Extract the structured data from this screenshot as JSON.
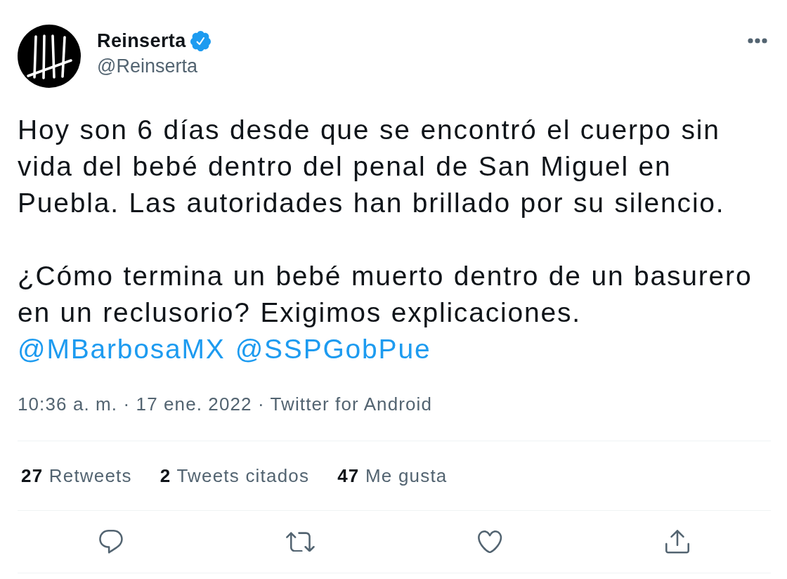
{
  "author": {
    "name": "Reinserta",
    "verified": true,
    "handle": "@Reinserta"
  },
  "tweet": {
    "paragraphs": [
      "Hoy son 6 días desde que se encontró el cuerpo sin vida del bebé dentro del penal de San Miguel en Puebla. Las autoridades han brillado por su silencio.",
      "¿Cómo termina un bebé muerto dentro de un basurero en un reclusorio? Exigimos explicaciones."
    ],
    "mentions": [
      "@MBarbosaMX",
      "@SSPGobPue"
    ],
    "timestamp": "10:36 a. m. · 17 ene. 2022 · Twitter for Android"
  },
  "stats": [
    {
      "count": "27",
      "label": "Retweets"
    },
    {
      "count": "2",
      "label": "Tweets citados"
    },
    {
      "count": "47",
      "label": "Me gusta"
    }
  ]
}
